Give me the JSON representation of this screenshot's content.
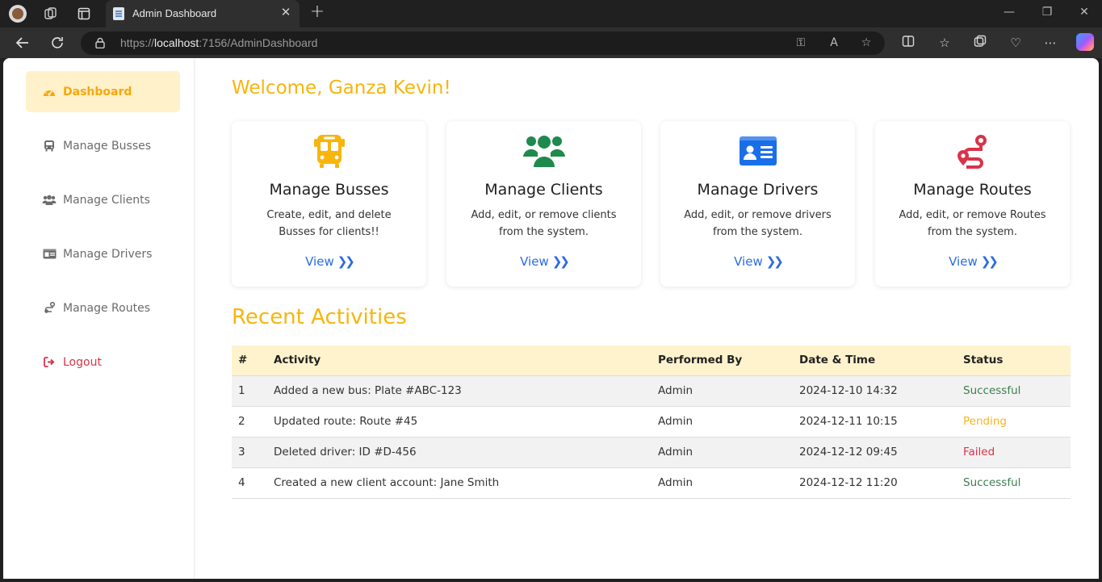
{
  "browser": {
    "tab_title": "Admin Dashboard",
    "tab_close": "✕",
    "new_tab": "+",
    "url_prefix": "https://",
    "url_host": "localhost",
    "url_rest": ":7156/AdminDashboard"
  },
  "sidebar": {
    "items": [
      {
        "label": "Dashboard",
        "icon": "gauge-icon",
        "active": true
      },
      {
        "label": "Manage Busses",
        "icon": "bus-icon"
      },
      {
        "label": "Manage Clients",
        "icon": "users-icon"
      },
      {
        "label": "Manage Drivers",
        "icon": "id-card-icon"
      },
      {
        "label": "Manage Routes",
        "icon": "route-icon"
      },
      {
        "label": "Logout",
        "icon": "logout-icon"
      }
    ]
  },
  "main": {
    "welcome": "Welcome, Ganza Kevin!",
    "cards": [
      {
        "title": "Manage Busses",
        "desc": "Create, edit, and delete Busses for clients!!",
        "link": "View",
        "icon": "bus-icon",
        "color": "#f7b50d"
      },
      {
        "title": "Manage Clients",
        "desc": "Add, edit, or remove clients from the system.",
        "link": "View",
        "icon": "users-icon",
        "color": "#1e8a4c"
      },
      {
        "title": "Manage Drivers",
        "desc": "Add, edit, or remove drivers from the system.",
        "link": "View",
        "icon": "id-card-icon",
        "color": "#1a6fe8"
      },
      {
        "title": "Manage Routes",
        "desc": "Add, edit, or remove Routes from the system.",
        "link": "View",
        "icon": "route-icon",
        "color": "#d9334a"
      }
    ],
    "recent_title": "Recent Activities",
    "table": {
      "headers": [
        "#",
        "Activity",
        "Performed By",
        "Date & Time",
        "Status"
      ],
      "rows": [
        {
          "num": "1",
          "activity": "Added a new bus: Plate #ABC-123",
          "by": "Admin",
          "date": "2024-12-10 14:32",
          "status": "Successful"
        },
        {
          "num": "2",
          "activity": "Updated route: Route #45",
          "by": "Admin",
          "date": "2024-12-11 10:15",
          "status": "Pending"
        },
        {
          "num": "3",
          "activity": "Deleted driver: ID #D-456",
          "by": "Admin",
          "date": "2024-12-12 09:45",
          "status": "Failed"
        },
        {
          "num": "4",
          "activity": "Created a new client account: Jane Smith",
          "by": "Admin",
          "date": "2024-12-12 11:20",
          "status": "Successful"
        }
      ]
    }
  },
  "colors": {
    "accent": "#f7b50d",
    "link": "#2a6be0",
    "success": "#3b7d4f",
    "pending": "#f5b423",
    "failed": "#d9334a"
  }
}
